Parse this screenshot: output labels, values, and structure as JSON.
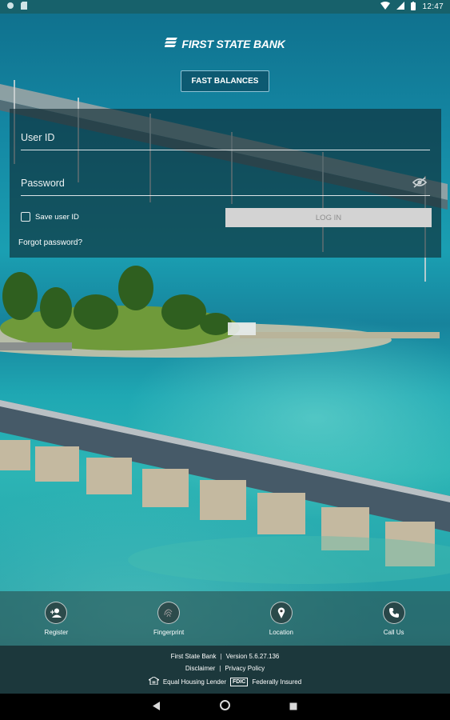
{
  "status_bar": {
    "time": "12:47",
    "left_icons": [
      "notification-icon",
      "sd-card-icon"
    ],
    "right_icons": [
      "wifi-icon",
      "signal-icon",
      "battery-icon"
    ]
  },
  "brand": {
    "name": "FIRST STATE BANK",
    "logo_icon": "bank-flag-icon"
  },
  "fast_balances_label": "FAST BALANCES",
  "login": {
    "user_id_placeholder": "User ID",
    "user_id_value": "",
    "password_placeholder": "Password",
    "password_value": "",
    "password_toggle_icon": "eye-off-icon",
    "save_user_id_label": "Save user ID",
    "save_user_id_checked": false,
    "login_button_label": "LOG IN",
    "forgot_password_label": "Forgot password?"
  },
  "bottom_nav": [
    {
      "label": "Register",
      "icon": "person-add-icon"
    },
    {
      "label": "Fingerprint",
      "icon": "fingerprint-icon"
    },
    {
      "label": "Location",
      "icon": "location-pin-icon"
    },
    {
      "label": "Call Us",
      "icon": "phone-icon"
    }
  ],
  "footer": {
    "bank_name": "First State Bank",
    "separator": "|",
    "version": "Version 5.6.27.136",
    "disclaimer": "Disclaimer",
    "privacy_policy": "Privacy Policy",
    "equal_housing": "Equal Housing Lender",
    "fdic_badge": "FDIC",
    "federally_insured": "Federally Insured"
  },
  "android_nav": [
    "back-icon",
    "home-icon",
    "recents-icon"
  ],
  "colors": {
    "status_bar": "#17616b",
    "footer_bg": "#1c383c",
    "login_button_bg": "#d3d3d3",
    "login_button_text": "#8d8d8d"
  }
}
